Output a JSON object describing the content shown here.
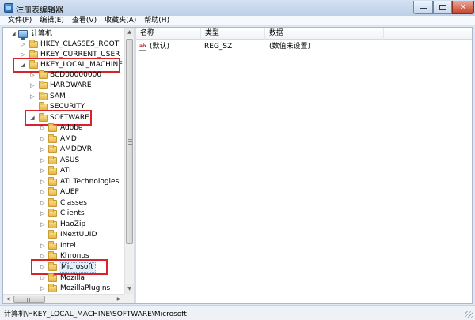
{
  "window": {
    "title": "注册表编辑器",
    "controls": {
      "minimize": "",
      "maximize": "",
      "close": "✕"
    }
  },
  "menu": [
    {
      "label": "文件(F)"
    },
    {
      "label": "编辑(E)"
    },
    {
      "label": "查看(V)"
    },
    {
      "label": "收藏夹(A)"
    },
    {
      "label": "帮助(H)"
    }
  ],
  "tree": {
    "root": "计算机",
    "hkcr": "HKEY_CLASSES_ROOT",
    "hkcu": "HKEY_CURRENT_USER",
    "hklm": "HKEY_LOCAL_MACHINE",
    "bcd": "BCD00000000",
    "hardware": "HARDWARE",
    "sam": "SAM",
    "security": "SECURITY",
    "software": "SOFTWARE",
    "software_children": [
      "Adobe",
      "AMD",
      "AMDDVR",
      "ASUS",
      "ATI",
      "ATI Technologies",
      "AUEP",
      "Classes",
      "Clients",
      "HaoZip",
      "INextUUID",
      "Intel",
      "Khronos",
      "Microsoft",
      "Mozilla",
      "MozillaPlugins"
    ],
    "expander_expanded": "◢",
    "expander_collapsed": "▷"
  },
  "list": {
    "columns": {
      "name": "名称",
      "type": "类型",
      "data": "数据"
    },
    "rows": [
      {
        "icon": "ab",
        "name": "(默认)",
        "type": "REG_SZ",
        "data": "(数值未设置)"
      }
    ]
  },
  "scrollbar": {
    "up": "▲",
    "down": "▼",
    "left": "◀",
    "right": "▶"
  },
  "status": {
    "path": "计算机\\HKEY_LOCAL_MACHINE\\SOFTWARE\\Microsoft"
  },
  "colors": {
    "highlight": "#d9232a",
    "selection": "#e3f0fb"
  }
}
